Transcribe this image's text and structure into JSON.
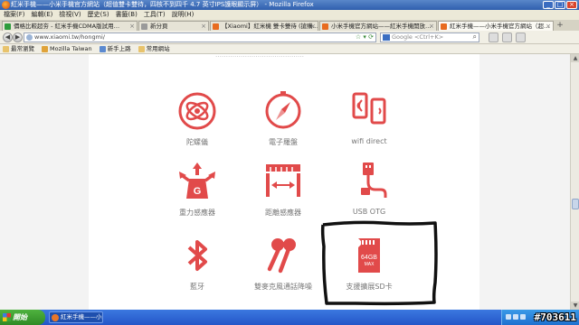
{
  "window": {
    "title": "紅米手機——小米手機官方網站（超值雙卡雙待，四核不到四千 4.7 英寸IPS護眼顯示屏） - Mozilla Firefox"
  },
  "menu": [
    "檔案(F)",
    "編輯(E)",
    "檢視(V)",
    "歷史(S)",
    "書籤(B)",
    "工具(T)",
    "說明(H)"
  ],
  "tabs": [
    {
      "label": "價格比較超夯 - 紅米手機CDMA版試用…",
      "active": false,
      "fav": "green"
    },
    {
      "label": "新分頁",
      "active": false,
      "fav": "gray"
    },
    {
      "label": "【Xiaomi】紅米機 雙卡雙待 (搶購…",
      "active": false,
      "fav": "orange"
    },
    {
      "label": "小米手機官方網站——紅米手機開放…",
      "active": false,
      "fav": "orange"
    },
    {
      "label": "紅米手機——小米手機官方網站（超…",
      "active": true,
      "fav": "orange"
    }
  ],
  "nav": {
    "url": "www.xiaomi.tw/hongmi/",
    "search_placeholder": "Google <Ctrl+K>"
  },
  "bookmarks": [
    "最常瀏覽",
    "Mozilla Taiwan",
    "新手上路",
    "常用網站"
  ],
  "page": {
    "partial_heading": "……………………………………"
  },
  "features": [
    {
      "icon": "gyroscope-icon",
      "label": "陀螺儀"
    },
    {
      "icon": "compass-icon",
      "label": "電子羅盤"
    },
    {
      "icon": "wifi-direct-icon",
      "label": "wifi direct"
    },
    {
      "icon": "gravity-sensor-icon",
      "label": "重力感應器"
    },
    {
      "icon": "distance-sensor-icon",
      "label": "距離感應器"
    },
    {
      "icon": "usb-otg-icon",
      "label": "USB OTG"
    },
    {
      "icon": "bluetooth-icon",
      "label": "藍牙"
    },
    {
      "icon": "dual-mic-icon",
      "label": "雙麥克風通話降噪"
    },
    {
      "icon": "sd-card-icon",
      "label": "支援擴展SD卡"
    }
  ],
  "sd_card_text": {
    "size": "64GB",
    "max": "MAX"
  },
  "gravity_letter": "G",
  "taskbar": {
    "start_label": "開始",
    "task_label": "紅米手機——小米…"
  },
  "watermark": "#703611",
  "colors": {
    "accent": "#e14a4a",
    "label": "#777777",
    "annotation": "#111111"
  }
}
